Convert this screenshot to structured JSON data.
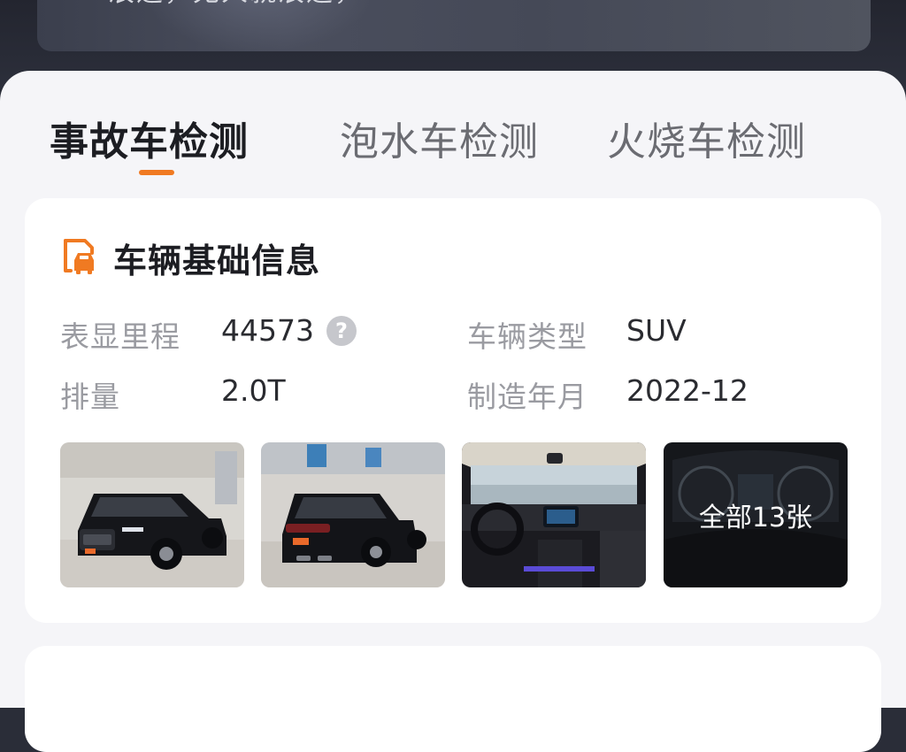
{
  "banner": {
    "text": "浪迹，无人就浪迹，"
  },
  "tabs": [
    {
      "label": "事故车检测",
      "active": true
    },
    {
      "label": "泡水车检测",
      "active": false
    },
    {
      "label": "火烧车检测",
      "active": false
    }
  ],
  "info": {
    "title": "车辆基础信息",
    "icon": "car-document-icon",
    "fields": {
      "mileage_label": "表显里程",
      "mileage_value": "44573",
      "type_label": "车辆类型",
      "type_value": "SUV",
      "displacement_label": "排量",
      "displacement_value": "2.0T",
      "date_label": "制造年月",
      "date_value": "2022-12"
    },
    "photos": {
      "all_label": "全部13张"
    }
  },
  "colors": {
    "accent": "#f07a22",
    "text_primary": "#1c1d22",
    "text_secondary": "#9a9ba1",
    "background": "#f5f5f8"
  }
}
